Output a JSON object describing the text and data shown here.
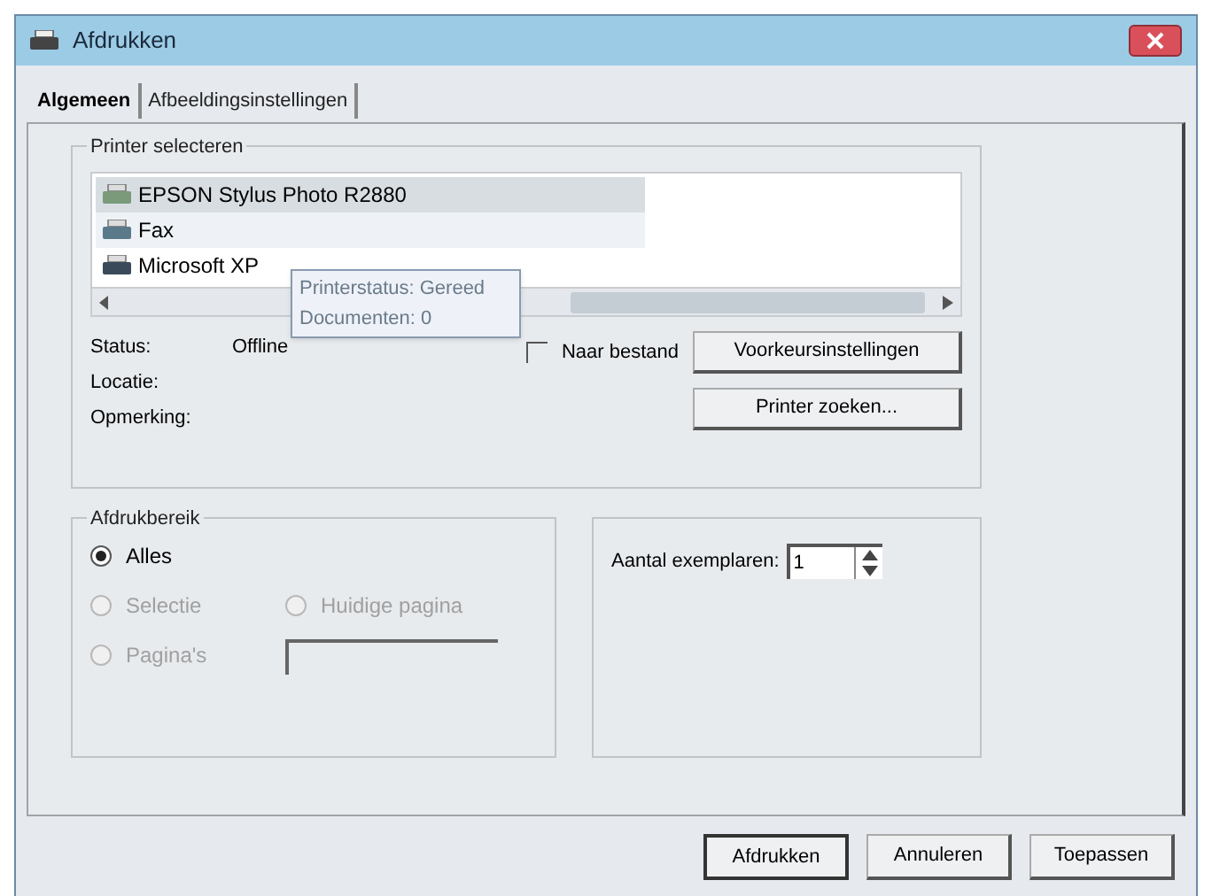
{
  "window": {
    "title": "Afdrukken"
  },
  "tabs": [
    {
      "label": "Algemeen",
      "selected": true
    },
    {
      "label": "Afbeeldingsinstellingen",
      "selected": false
    }
  ],
  "printer_group": {
    "title": "Printer selecteren",
    "printers": [
      {
        "name": "EPSON Stylus Photo R2880",
        "kind": "photo",
        "selected": true,
        "hovered": false
      },
      {
        "name": "Fax",
        "kind": "fax",
        "selected": false,
        "hovered": true
      },
      {
        "name": "Microsoft XP",
        "kind": "printer",
        "selected": false,
        "hovered": false
      }
    ],
    "tooltip": [
      "Printerstatus: Gereed",
      "Documenten: 0"
    ],
    "info": [
      {
        "label": "Status:",
        "value": "Offline"
      },
      {
        "label": "Locatie:"
      },
      {
        "label": "Opmerking:"
      }
    ],
    "print_to_file": {
      "label": "Naar bestand",
      "checked": false
    },
    "buttons": [
      "Voorkeursinstellingen",
      "Printer zoeken..."
    ]
  },
  "range_group": {
    "title": "Afdrukbereik",
    "options": [
      {
        "label": "Alles",
        "selected": true,
        "disabled": false
      },
      {
        "label": "Selectie",
        "selected": false,
        "disabled": true
      },
      {
        "label": "Huidige pagina",
        "selected": false,
        "disabled": true
      },
      {
        "label": "Pagina's",
        "selected": false,
        "disabled": true
      }
    ],
    "pages_field": {
      "disabled": true
    }
  },
  "copies": {
    "label": "Aantal exemplaren:",
    "value": "1"
  },
  "footer_buttons": [
    {
      "label": "Afdrukken",
      "default": true
    },
    {
      "label": "Annuleren",
      "default": false
    },
    {
      "label": "Toepassen",
      "default": false
    }
  ]
}
